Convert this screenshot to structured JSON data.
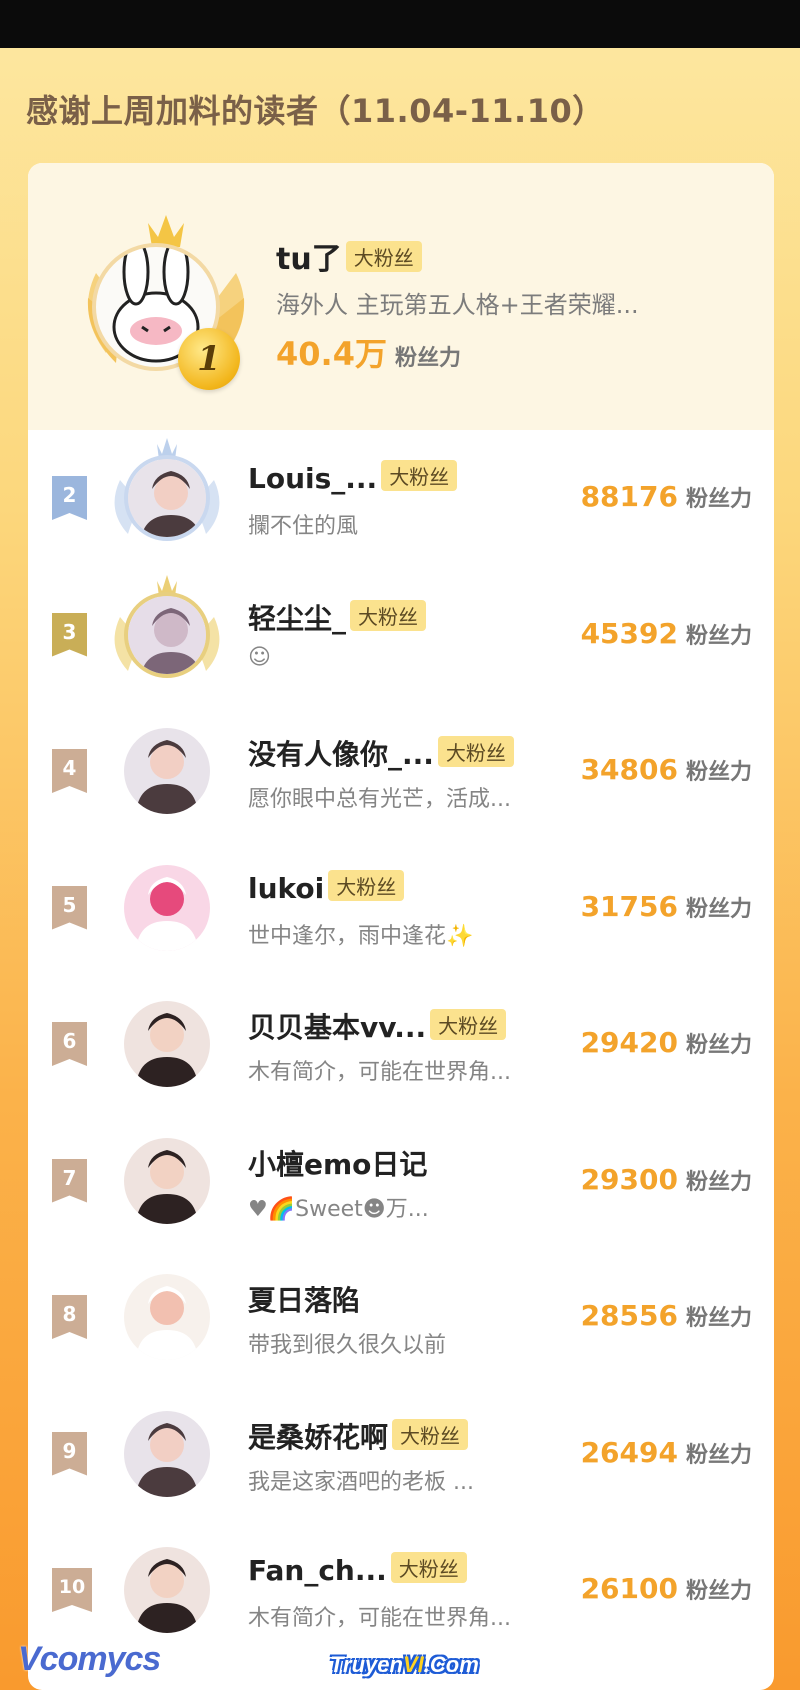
{
  "header": {
    "title": "感谢上周加料的读者（11.04-11.10）"
  },
  "first_place": {
    "rank": "1",
    "name": "tu了",
    "badge": "大粉丝",
    "bio": "海外人 主玩第五人格+王者荣耀...",
    "score": "40.4万",
    "score_unit": "粉丝力"
  },
  "ranking": [
    {
      "rank": "2",
      "name": "Louis_...",
      "badge": "大粉丝",
      "bio": "攔不住的風",
      "score": "88176",
      "unit": "粉丝力",
      "ribbon_color": "#9bb6dd",
      "avatar": "couple-avatar-icon"
    },
    {
      "rank": "3",
      "name": "轻尘尘_",
      "badge": "大粉丝",
      "bio": "☺",
      "score": "45392",
      "unit": "粉丝力",
      "ribbon_color": "#c9ae57",
      "avatar": "figure-avatar-icon"
    },
    {
      "rank": "4",
      "name": "没有人像你_...",
      "badge": "大粉丝",
      "bio": "愿你眼中总有光芒，活成...",
      "score": "34806",
      "unit": "粉丝力",
      "ribbon_color": "#ccad95",
      "avatar": "couple-avatar-icon"
    },
    {
      "rank": "5",
      "name": "lukoi",
      "badge": "大粉丝",
      "bio": "世中逢尔，雨中逢花✨",
      "score": "31756",
      "unit": "粉丝力",
      "ribbon_color": "#ccad95",
      "avatar": "kitty-avatar-icon"
    },
    {
      "rank": "6",
      "name": "贝贝基本vv...",
      "badge": "大粉丝",
      "bio": "木有简介，可能在世界角...",
      "score": "29420",
      "unit": "粉丝力",
      "ribbon_color": "#ccad95",
      "avatar": "person-avatar-icon"
    },
    {
      "rank": "7",
      "name": "小檀emo日记",
      "badge": "",
      "bio": "♥🌈Sweet☻万...",
      "score": "29300",
      "unit": "粉丝力",
      "ribbon_color": "#ccad95",
      "avatar": "person-avatar-icon"
    },
    {
      "rank": "8",
      "name": "夏日落陷",
      "badge": "",
      "bio": "带我到很久很久以前",
      "score": "28556",
      "unit": "粉丝力",
      "ribbon_color": "#ccad95",
      "avatar": "sheep-avatar-icon"
    },
    {
      "rank": "9",
      "name": "是桑娇花啊",
      "badge": "大粉丝",
      "bio": "我是这家酒吧的老板  ...",
      "score": "26494",
      "unit": "粉丝力",
      "ribbon_color": "#ccad95",
      "avatar": "couple-avatar-icon"
    },
    {
      "rank": "10",
      "name": "Fan_ch...",
      "badge": "大粉丝",
      "bio": "木有简介，可能在世界角...",
      "score": "26100",
      "unit": "粉丝力",
      "ribbon_color": "#ccad95",
      "avatar": "person-avatar-icon"
    }
  ],
  "watermarks": {
    "left": "Vcomycs",
    "right_a": "Truyen",
    "right_b": "VI",
    "right_c": ".Com"
  }
}
